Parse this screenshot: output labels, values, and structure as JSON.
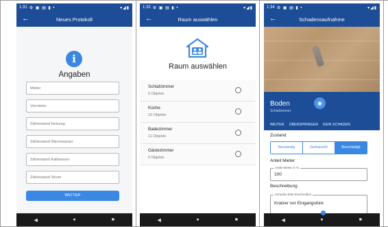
{
  "screens": {
    "s1": {
      "status": {
        "time": "1:31",
        "icons": "⚙ ▣ ▤ ▮ •",
        "right": "▾◢▮"
      },
      "appbar": {
        "back": "←",
        "title": "Neues Protokoll"
      },
      "heading": "Angaben",
      "fields": [
        {
          "placeholder": "Mieter"
        },
        {
          "placeholder": "Vormieter"
        },
        {
          "placeholder": "Zählerstand Heizung"
        },
        {
          "placeholder": "Zählerstand Warmwasser"
        },
        {
          "placeholder": "Zählerstand Kaltwasser"
        },
        {
          "placeholder": "Zählerstand Strom"
        }
      ],
      "button": "WEITER"
    },
    "s2": {
      "status": {
        "time": "1:32",
        "icons": "⚙ ▣ ▤ ▮ •",
        "right": "▾◢▮"
      },
      "appbar": {
        "back": "←",
        "title": "Raum auswählen"
      },
      "heading": "Raum auswählen",
      "rooms": [
        {
          "name": "Schlafzimmer",
          "count": "6 Objekte"
        },
        {
          "name": "Küche",
          "count": "10 Objekte"
        },
        {
          "name": "Badezimmer",
          "count": "11 Objekte"
        },
        {
          "name": "Gästezimmer",
          "count": "6 Objekte"
        }
      ]
    },
    "s3": {
      "status": {
        "time": "1:34",
        "icons": "⚙ ▣ ▤ ▮ •",
        "right": "▾◢▮"
      },
      "appbar": {
        "back": "←",
        "title": "Schadensaufnahme"
      },
      "item_title": "Boden",
      "item_sub": "Schlafzimmer",
      "actions": {
        "next": "WEITER",
        "skip": "ÜBERSPRINGEN",
        "none": "KEIN SCHADEN"
      },
      "zustand_label": "Zustand",
      "zustand_options": [
        "Neuwertig",
        "Gebraucht",
        "Beschädigt"
      ],
      "zustand_selected": "Beschädigt",
      "anteil_label": "Anteil Mieter",
      "anteil_field_label": "Anteil Mieter in %",
      "anteil_value": "100",
      "beschreibung_label": "Beschreibung",
      "beschreibung_field_label": "Schaden bitte beschreiben",
      "beschreibung_value": "Kratzer vor Eingangstüre"
    }
  },
  "navbar": {
    "back": "◀",
    "home": "●",
    "recents": "■"
  },
  "colors": {
    "appbar": "#1d4d96",
    "accent": "#3b87e4",
    "navbar": "#1a1a1a"
  },
  "icons": {
    "info": "info-icon",
    "room": "room-icon",
    "camera": "camera-icon"
  }
}
